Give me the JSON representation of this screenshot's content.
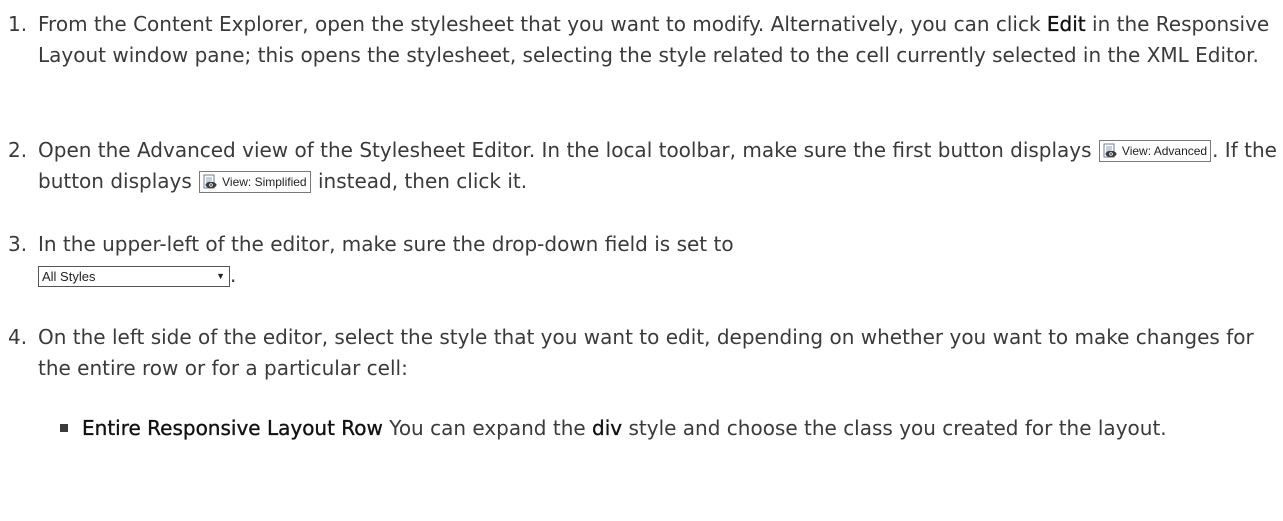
{
  "steps": [
    {
      "number": "1.",
      "pre": "From the Content Explorer, open the stylesheet that you want to modify. Alternatively, you can click ",
      "bold": "Edit",
      "post": " in the Responsive Layout window pane; this opens the stylesheet, selecting the style related to the cell currently selected in the XML Editor."
    },
    {
      "number": "2.",
      "text_a": "Open the Advanced view of the Stylesheet Editor. In the local toolbar, make sure the first button displays ",
      "button_a": "View: Advanced",
      "text_b": ". If the button displays ",
      "button_b": "View: Simplified",
      "text_c": " instead, then click it."
    },
    {
      "number": "3.",
      "text": "In the upper-left of the editor, make sure the drop-down field is set to",
      "dropdown_value": "All Styles",
      "end": "."
    },
    {
      "number": "4.",
      "text": "On the left side of the editor, select the style that you want to edit, depending on whether you want to make changes for the entire row or for a particular cell:",
      "bullets": [
        {
          "bold": "Entire Responsive Layout Row",
          "pre": " You can expand the ",
          "bold2": "div",
          "post": " style and choose the class you created for the layout."
        }
      ]
    }
  ],
  "icons": {
    "view_button_icon": "eye-stylesheet-icon",
    "dropdown_caret": "chevron-down-icon"
  }
}
